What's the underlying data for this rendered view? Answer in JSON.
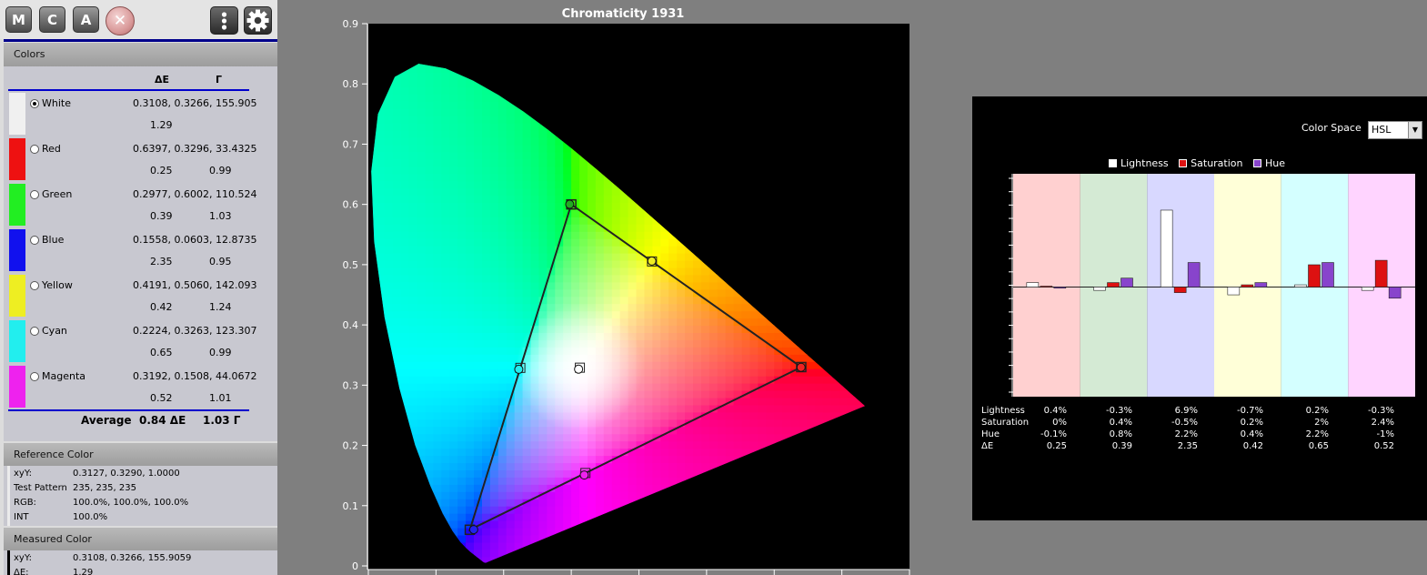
{
  "toolbar": {
    "m_label": "M",
    "c_label": "C",
    "a_label": "A",
    "close_label": "✕"
  },
  "colors_panel": {
    "header": "Colors",
    "col_de": "ΔE",
    "col_gamma": "Γ",
    "items": [
      {
        "name": "White",
        "xyY": "0.3108, 0.3266, 155.905",
        "de": "1.29",
        "gamma": "",
        "swatch": "#f0f0f0",
        "selected": true
      },
      {
        "name": "Red",
        "xyY": "0.6397, 0.3296, 33.4325",
        "de": "0.25",
        "gamma": "0.99",
        "swatch": "#ee1111",
        "selected": false
      },
      {
        "name": "Green",
        "xyY": "0.2977, 0.6002, 110.524",
        "de": "0.39",
        "gamma": "1.03",
        "swatch": "#22ee22",
        "selected": false
      },
      {
        "name": "Blue",
        "xyY": "0.1558, 0.0603, 12.8735",
        "de": "2.35",
        "gamma": "0.95",
        "swatch": "#1111ee",
        "selected": false
      },
      {
        "name": "Yellow",
        "xyY": "0.4191, 0.5060, 142.093",
        "de": "0.42",
        "gamma": "1.24",
        "swatch": "#eeee22",
        "selected": false
      },
      {
        "name": "Cyan",
        "xyY": "0.2224, 0.3263, 123.307",
        "de": "0.65",
        "gamma": "0.99",
        "swatch": "#22eeee",
        "selected": false
      },
      {
        "name": "Magenta",
        "xyY": "0.3192, 0.1508, 44.0672",
        "de": "0.52",
        "gamma": "1.01",
        "swatch": "#ee22ee",
        "selected": false
      }
    ],
    "average_label": "Average",
    "average_de": "0.84 ΔE",
    "average_gamma": "1.03 Γ"
  },
  "reference_color": {
    "header": "Reference Color",
    "rows": [
      {
        "label": "xyY:",
        "value": "0.3127, 0.3290, 1.0000"
      },
      {
        "label": "Test Pattern",
        "value": "235, 235, 235"
      },
      {
        "label": "RGB:",
        "value": "100.0%, 100.0%, 100.0%"
      },
      {
        "label": "INT",
        "value": "100.0%"
      }
    ]
  },
  "measured_color": {
    "header": "Measured Color",
    "rows": [
      {
        "label": "xyY:",
        "value": "0.3108, 0.3266, 155.9059"
      },
      {
        "label": "ΔE:",
        "value": "1.29"
      }
    ]
  },
  "chart_data": [
    {
      "type": "scatter",
      "title": "Chromaticity 1931",
      "xlim": [
        0,
        0.8
      ],
      "ylim": [
        0,
        0.9
      ],
      "yticks": [
        "0",
        "0.1",
        "0.2",
        "0.3",
        "0.4",
        "0.5",
        "0.6",
        "0.7",
        "0.8",
        "0.9"
      ],
      "gamut_target": [
        {
          "name": "Red",
          "x": 0.64,
          "y": 0.33
        },
        {
          "name": "Green",
          "x": 0.3,
          "y": 0.6
        },
        {
          "name": "Blue",
          "x": 0.15,
          "y": 0.06
        }
      ],
      "points": [
        {
          "name": "Red",
          "x": 0.6397,
          "y": 0.3296,
          "color": "#ee2222"
        },
        {
          "name": "Green",
          "x": 0.2977,
          "y": 0.6002,
          "color": "#22aa22"
        },
        {
          "name": "Blue",
          "x": 0.1558,
          "y": 0.0603,
          "color": "#2222ee"
        },
        {
          "name": "Yellow",
          "x": 0.4191,
          "y": 0.506,
          "color": "#eeee22"
        },
        {
          "name": "Cyan",
          "x": 0.2224,
          "y": 0.3263,
          "color": "#22eeee"
        },
        {
          "name": "Magenta",
          "x": 0.3192,
          "y": 0.1508,
          "color": "#ee22ee"
        },
        {
          "name": "White",
          "x": 0.3108,
          "y": 0.3266,
          "color": "#ffffff"
        }
      ]
    },
    {
      "type": "bar",
      "categories": [
        "Red",
        "Green",
        "Blue",
        "Yellow",
        "Cyan",
        "Magenta"
      ],
      "band_colors": [
        "#ffd0d0",
        "#d4ead4",
        "#d8d8ff",
        "#ffffd8",
        "#d4ffff",
        "#ffd4ff"
      ],
      "series": [
        {
          "name": "Lightness",
          "color": "#ffffff",
          "values": [
            0.4,
            -0.3,
            6.9,
            -0.7,
            0.2,
            -0.3
          ]
        },
        {
          "name": "Saturation",
          "color": "#dd1111",
          "values": [
            0,
            0.4,
            -0.5,
            0.2,
            2,
            2.4
          ]
        },
        {
          "name": "Hue",
          "color": "#8844cc",
          "values": [
            -0.1,
            0.8,
            2.2,
            0.4,
            2.2,
            -1
          ]
        }
      ],
      "ylim": [
        -30,
        30
      ]
    }
  ],
  "hsl_panel": {
    "color_space_label": "Color Space",
    "color_space_value": "HSL",
    "legend": [
      "Lightness",
      "Saturation",
      "Hue"
    ],
    "table": {
      "labels": [
        "Lightness",
        "Saturation",
        "Hue",
        "ΔE"
      ],
      "columns": [
        [
          "0.4%",
          "0%",
          "-0.1%",
          "0.25"
        ],
        [
          "-0.3%",
          "0.4%",
          "0.8%",
          "0.39"
        ],
        [
          "6.9%",
          "-0.5%",
          "2.2%",
          "2.35"
        ],
        [
          "-0.7%",
          "0.2%",
          "0.4%",
          "0.42"
        ],
        [
          "0.2%",
          "2%",
          "2.2%",
          "0.65"
        ],
        [
          "-0.3%",
          "2.4%",
          "-1%",
          "0.52"
        ]
      ]
    }
  }
}
